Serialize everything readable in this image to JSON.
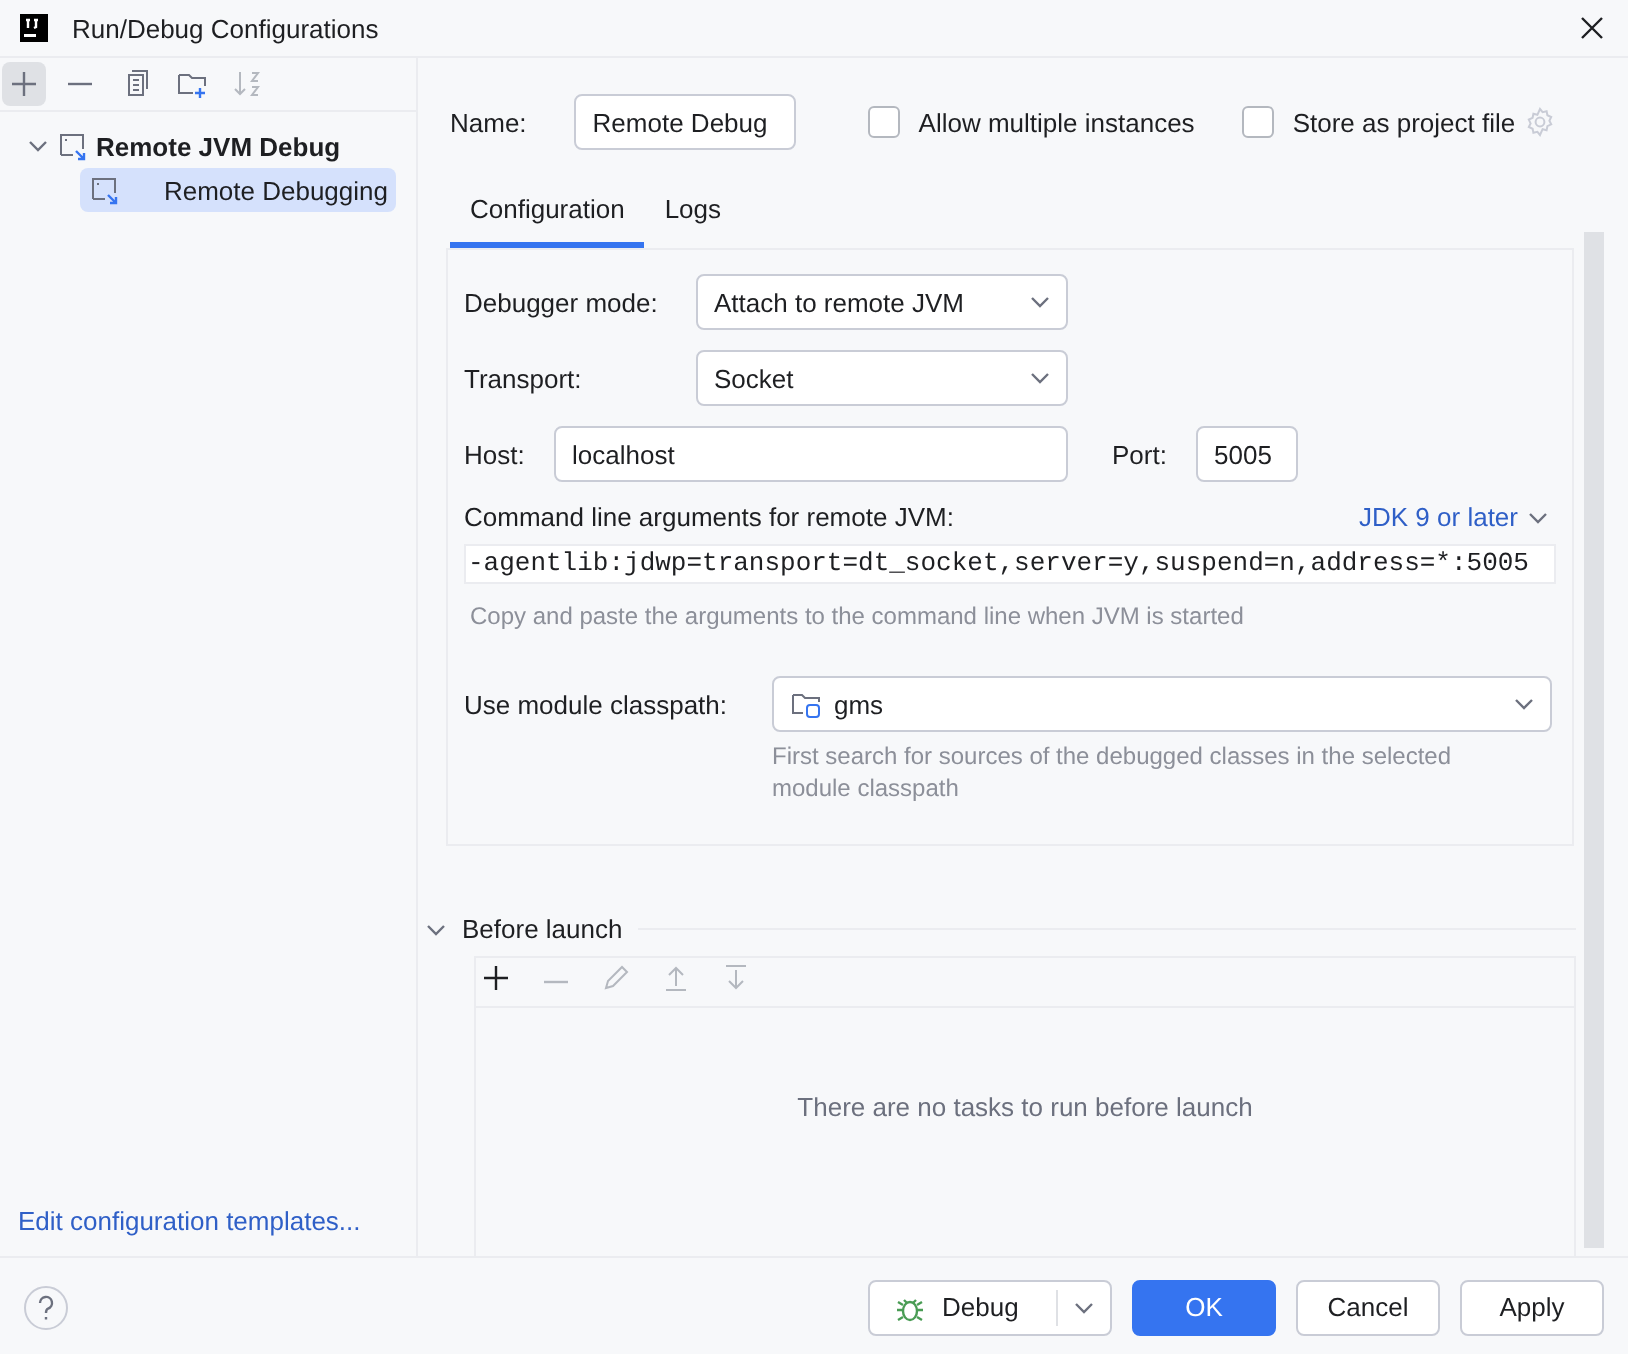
{
  "window": {
    "title": "Run/Debug Configurations"
  },
  "sidebar": {
    "tree": [
      {
        "label": "Remote JVM Debug",
        "expanded": true,
        "selected": false,
        "children": [
          {
            "label": "Remote Debugging",
            "selected": true
          }
        ]
      }
    ],
    "footer_link": "Edit configuration templates..."
  },
  "name_field": {
    "label": "Name:",
    "value": "Remote Debug"
  },
  "options": [
    {
      "label": "Allow multiple instances",
      "checked": false
    },
    {
      "label": "Store as project file",
      "checked": false
    }
  ],
  "tabs": [
    {
      "label": "Configuration",
      "selected": true
    },
    {
      "label": "Logs",
      "selected": false
    }
  ],
  "form": {
    "debugger_mode": {
      "label": "Debugger mode:",
      "value": "Attach to remote JVM"
    },
    "transport": {
      "label": "Transport:",
      "value": "Socket"
    },
    "host": {
      "label": "Host:",
      "value": "localhost"
    },
    "port": {
      "label": "Port:",
      "value": "5005"
    },
    "command_line": {
      "label": "Command line arguments for remote JVM:",
      "jdk_link": "JDK 9 or later",
      "value": "-agentlib:jdwp=transport=dt_socket,server=y,suspend=n,address=*:5005",
      "hint": "Copy and paste the arguments to the command line when JVM is started"
    },
    "module_classpath": {
      "label": "Use module classpath:",
      "value": "gms",
      "hint": "First search for sources of the debugged classes in the selected module classpath"
    }
  },
  "before_launch": {
    "title": "Before launch",
    "expanded": true,
    "empty_text": "There are no tasks to run before launch"
  },
  "buttons": [
    {
      "label": "Debug",
      "kind": "run"
    },
    {
      "label": "OK",
      "kind": "primary"
    },
    {
      "label": "Cancel",
      "kind": "plain"
    },
    {
      "label": "Apply",
      "kind": "plain"
    }
  ]
}
